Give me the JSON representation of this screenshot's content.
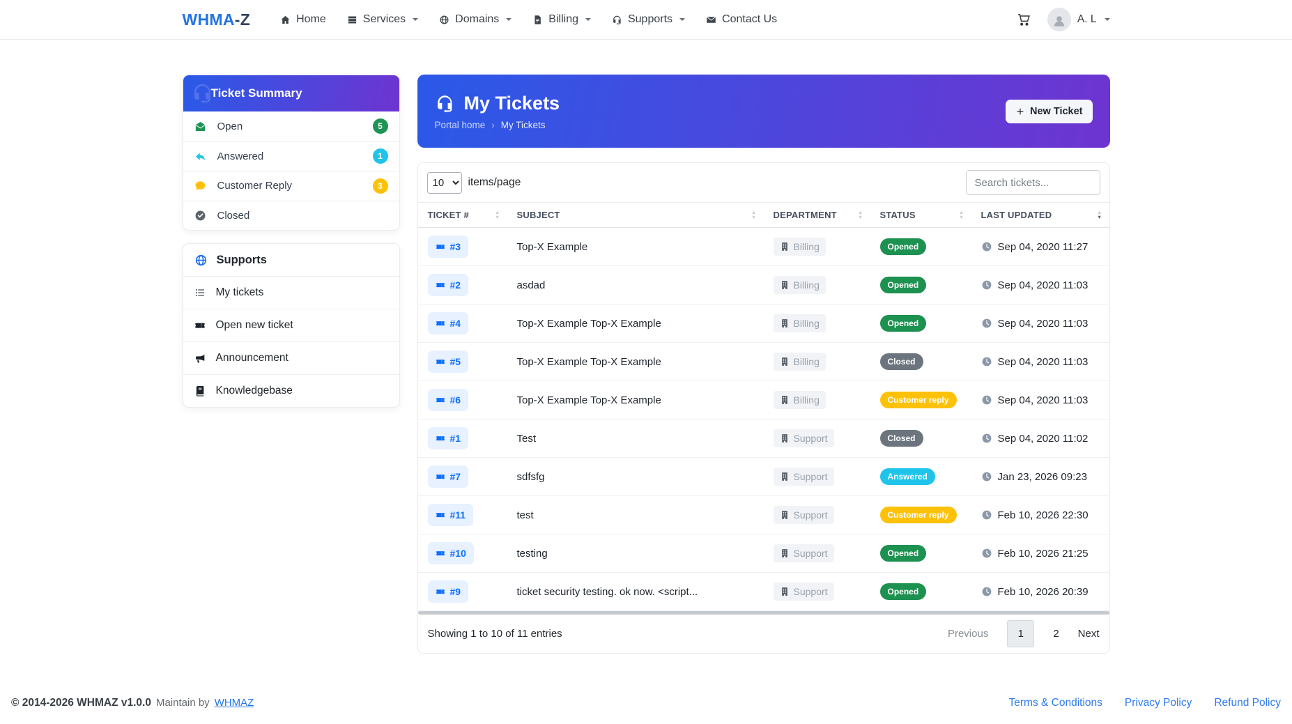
{
  "navbar": {
    "brand": {
      "part1": "WHMA",
      "part2": "-Z"
    },
    "items": [
      {
        "label": "Home",
        "icon": "home-icon",
        "dropdown": false
      },
      {
        "label": "Services",
        "icon": "server-icon",
        "dropdown": true
      },
      {
        "label": "Domains",
        "icon": "globe-icon",
        "dropdown": true
      },
      {
        "label": "Billing",
        "icon": "invoice-icon",
        "dropdown": true
      },
      {
        "label": "Supports",
        "icon": "headset-icon",
        "dropdown": true
      },
      {
        "label": "Contact Us",
        "icon": "envelope-icon",
        "dropdown": false
      }
    ],
    "user": {
      "name": "A. L"
    }
  },
  "ticket_summary": {
    "title": "Ticket Summary",
    "items": [
      {
        "label": "Open",
        "count": "5",
        "icon": "envelope-open-icon",
        "color": "#1e9455"
      },
      {
        "label": "Answered",
        "count": "1",
        "icon": "reply-icon",
        "color": "#1ec4ea"
      },
      {
        "label": "Customer Reply",
        "count": "3",
        "icon": "comment-icon",
        "color": "#fdc107"
      },
      {
        "label": "Closed",
        "count": "",
        "icon": "check-circle-icon",
        "color": "#5d646b"
      }
    ]
  },
  "supports_menu": {
    "title": "Supports",
    "items": [
      {
        "label": "My tickets",
        "icon": "list-icon"
      },
      {
        "label": "Open new ticket",
        "icon": "ticket-icon"
      },
      {
        "label": "Announcement",
        "icon": "bullhorn-icon"
      },
      {
        "label": "Knowledgebase",
        "icon": "book-icon"
      }
    ]
  },
  "page_header": {
    "title": "My Tickets",
    "breadcrumb_home": "Portal home",
    "breadcrumb_separator": "›",
    "breadcrumb_current": "My Tickets",
    "new_ticket_label": "New Ticket"
  },
  "table": {
    "items_per_page": "10",
    "items_page_label": "items/page",
    "search_placeholder": "Search tickets...",
    "columns": [
      "TICKET #",
      "SUBJECT",
      "DEPARTMENT",
      "STATUS",
      "LAST UPDATED"
    ],
    "rows": [
      {
        "ticket": "#3",
        "subject": "Top-X Example",
        "department": "Billing",
        "status": "Opened",
        "updated": "Sep 04, 2020 11:27"
      },
      {
        "ticket": "#2",
        "subject": "asdad",
        "department": "Billing",
        "status": "Opened",
        "updated": "Sep 04, 2020 11:03"
      },
      {
        "ticket": "#4",
        "subject": "Top-X Example Top-X Example",
        "department": "Billing",
        "status": "Opened",
        "updated": "Sep 04, 2020 11:03"
      },
      {
        "ticket": "#5",
        "subject": "Top-X Example Top-X Example",
        "department": "Billing",
        "status": "Closed",
        "updated": "Sep 04, 2020 11:03"
      },
      {
        "ticket": "#6",
        "subject": "Top-X Example Top-X Example",
        "department": "Billing",
        "status": "Customer reply",
        "updated": "Sep 04, 2020 11:03"
      },
      {
        "ticket": "#1",
        "subject": "Test",
        "department": "Support",
        "status": "Closed",
        "updated": "Sep 04, 2020 11:02"
      },
      {
        "ticket": "#7",
        "subject": "sdfsfg",
        "department": "Support",
        "status": "Answered",
        "updated": "Jan 23, 2026 09:23"
      },
      {
        "ticket": "#11",
        "subject": "test",
        "department": "Support",
        "status": "Customer reply",
        "updated": "Feb 10, 2026 22:30"
      },
      {
        "ticket": "#10",
        "subject": "testing",
        "department": "Support",
        "status": "Opened",
        "updated": "Feb 10, 2026 21:25"
      },
      {
        "ticket": "#9",
        "subject": "ticket security testing. ok now. <script...",
        "department": "Support",
        "status": "Opened",
        "updated": "Feb 10, 2026 20:39"
      }
    ],
    "summary": "Showing 1 to 10 of 11 entries",
    "pagination": {
      "previous": "Previous",
      "pages": [
        "1",
        "2"
      ],
      "active_page": "1",
      "next": "Next"
    }
  },
  "footer": {
    "copyright": "© 2014-2026 WHMAZ v1.0.0",
    "maintain": "Maintain by",
    "maintain_link": "WHMAZ",
    "links": [
      "Terms & Conditions",
      "Privacy Policy",
      "Refund Policy"
    ]
  },
  "colors": {
    "status": {
      "Opened": "#1d9150",
      "Closed": "#6c757d",
      "Customer reply": "#fdc107",
      "Answered": "#1ec4ea"
    },
    "gradient_start": "#2d58e7",
    "gradient_end": "#6c35d1"
  }
}
